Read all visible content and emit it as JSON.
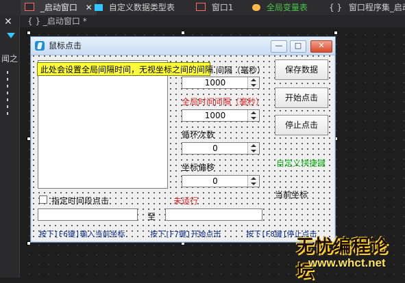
{
  "ide": {
    "tabs": [
      {
        "label": "_启动窗口",
        "active": true
      },
      {
        "label": "自定义数据类型表",
        "active": false
      },
      {
        "label": "窗口1",
        "active": false
      },
      {
        "label": "全局变量表",
        "active": false
      },
      {
        "label": "窗口程序集_启动窗",
        "active": false
      }
    ],
    "breadcrumb": "{ } _启动窗口 *",
    "left_rail_text": "闻之"
  },
  "window": {
    "title": "鼠标点击",
    "buttons": {
      "min": "—",
      "max": "□",
      "close": "✕"
    },
    "tooltip": "此处会设置全局间隔时间，无视坐标之间的间隔",
    "labels": {
      "interval_partial": "间隔（毫秒）",
      "global_interval": "全局时间间隔（毫秒）",
      "loop_count": "循环次数",
      "coord_offset": "坐标偏移",
      "custom_hotkey": "自定义快捷键",
      "current_coords": "当前坐标",
      "not_running": "未运行",
      "to": "至",
      "time_range_check": "指定时间段点击",
      "hint_f6": "按下[F6键]输入当前坐标",
      "hint_f7": "按下[F7键]开始点击",
      "hint_f8": "按下[F8键]停止点击"
    },
    "spinners": {
      "interval": "1000",
      "global_interval": "1000",
      "loop_count": "0",
      "coord_offset": "0"
    },
    "actions": {
      "save": "保存数据",
      "start": "开始点击",
      "stop": "停止点击"
    }
  },
  "watermark": {
    "line1": "无忧编程论坛",
    "line2": "www.whct.net"
  }
}
